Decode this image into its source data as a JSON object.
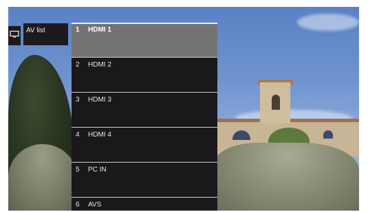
{
  "header": {
    "source_icon": "tv-monitor-icon",
    "title": "AV list"
  },
  "av_list": {
    "items": [
      {
        "number": "1",
        "label": "HDMI 1",
        "selected": true
      },
      {
        "number": "2",
        "label": "HDMI 2",
        "selected": false
      },
      {
        "number": "3",
        "label": "HDMI 3",
        "selected": false
      },
      {
        "number": "4",
        "label": "HDMI 4",
        "selected": false
      },
      {
        "number": "5",
        "label": "PC IN",
        "selected": false
      },
      {
        "number": "6",
        "label": "AVS",
        "selected": false
      }
    ]
  },
  "colors": {
    "panel": "#1a181b",
    "selected": "#747373",
    "text": "#e6e6e6"
  }
}
